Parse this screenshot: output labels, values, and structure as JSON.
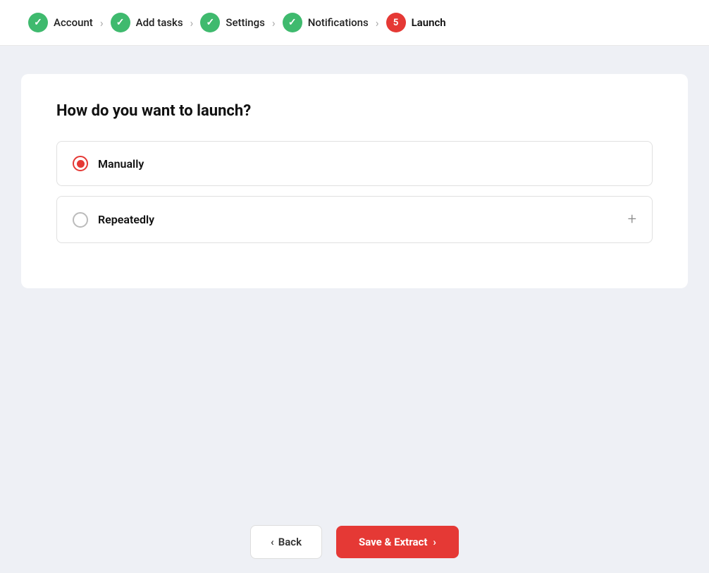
{
  "stepper": {
    "steps": [
      {
        "id": "account",
        "label": "Account",
        "state": "done",
        "number": null
      },
      {
        "id": "add-tasks",
        "label": "Add tasks",
        "state": "done",
        "number": null
      },
      {
        "id": "settings",
        "label": "Settings",
        "state": "done",
        "number": null
      },
      {
        "id": "notifications",
        "label": "Notifications",
        "state": "done",
        "number": null
      },
      {
        "id": "launch",
        "label": "Launch",
        "state": "active",
        "number": "5"
      }
    ]
  },
  "card": {
    "title": "How do you want to launch?",
    "options": [
      {
        "id": "manually",
        "label": "Manually",
        "selected": true
      },
      {
        "id": "repeatedly",
        "label": "Repeatedly",
        "selected": false
      }
    ]
  },
  "footer": {
    "back_label": "Back",
    "save_label": "Save & Extract"
  }
}
